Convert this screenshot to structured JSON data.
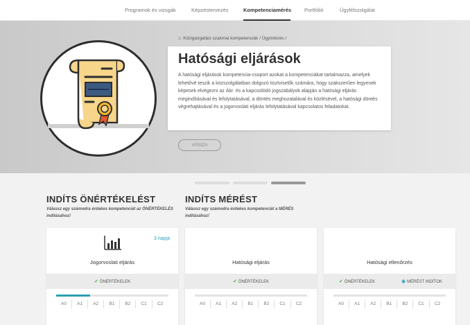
{
  "nav": {
    "items": [
      {
        "label": "Programok és vizsgák"
      },
      {
        "label": "Képzéstervezés"
      },
      {
        "label": "Kompetenciamérés",
        "active": true
      },
      {
        "label": "Portfólió"
      },
      {
        "label": "Ügyfélszolgálat"
      }
    ]
  },
  "breadcrumb": {
    "home_icon": "home-icon",
    "path": "Közigazgatási szakmai kompetenciák  /  Ügyintézés  /"
  },
  "hero": {
    "title": "Hatósági eljárások",
    "description": "A hatósági eljárások kompetencia-csoport azokat a kompetenciákat tartalmazza, amelyek lehetővé teszik a közszolgálatban dolgozó tisztviselők számára, hogy szakszerűen legyenek képesek elvégezni az Ákr. és a kapcsolódó jogszabályok alapján a hatósági eljárás megindításával és lefolytatásával, a döntés meghozatalával és közlésével, a hatósági döntés végrehajtásával és a jogorvoslati eljárás lefolytatásával kapcsolatos feladatokat.",
    "back_label": "VISSZA",
    "icon": "certificate-scroll-icon"
  },
  "carousel": {
    "count": 3,
    "active": 2
  },
  "self_eval": {
    "title": "INDÍTS ÖNÉRTÉKELÉST",
    "subtitle": "Válassz egy számodra érdekes kompetenciát az ÖNÉRTÉKELÉS indításához!"
  },
  "measure": {
    "title": "INDÍTS MÉRÉST",
    "subtitle": "Válassz egy számodra érdekes kompetenciát a MÉRÉS indításához!"
  },
  "tiles": [
    {
      "name": "Jogorvoslati eljárás",
      "days": "3 napja",
      "actions": [
        "ÖNÉRTÉKELEK"
      ],
      "progress": 0.3
    },
    {
      "name": "Hatósági eljárás",
      "actions": [
        "ÖNÉRTÉKELEK"
      ],
      "progress": 0
    },
    {
      "name": "Hatósági ellenőrzés",
      "actions": [
        "ÖNÉRTÉKELEK",
        "MÉRÉST INDÍTOK"
      ],
      "progress": 0
    }
  ],
  "levels": [
    "A0",
    "A1",
    "A2",
    "B1",
    "B2",
    "C1",
    "C2"
  ],
  "colors": {
    "accent": "#2a9fb3",
    "check": "#4cae4c",
    "hero_bg": "#cfcfcf"
  }
}
